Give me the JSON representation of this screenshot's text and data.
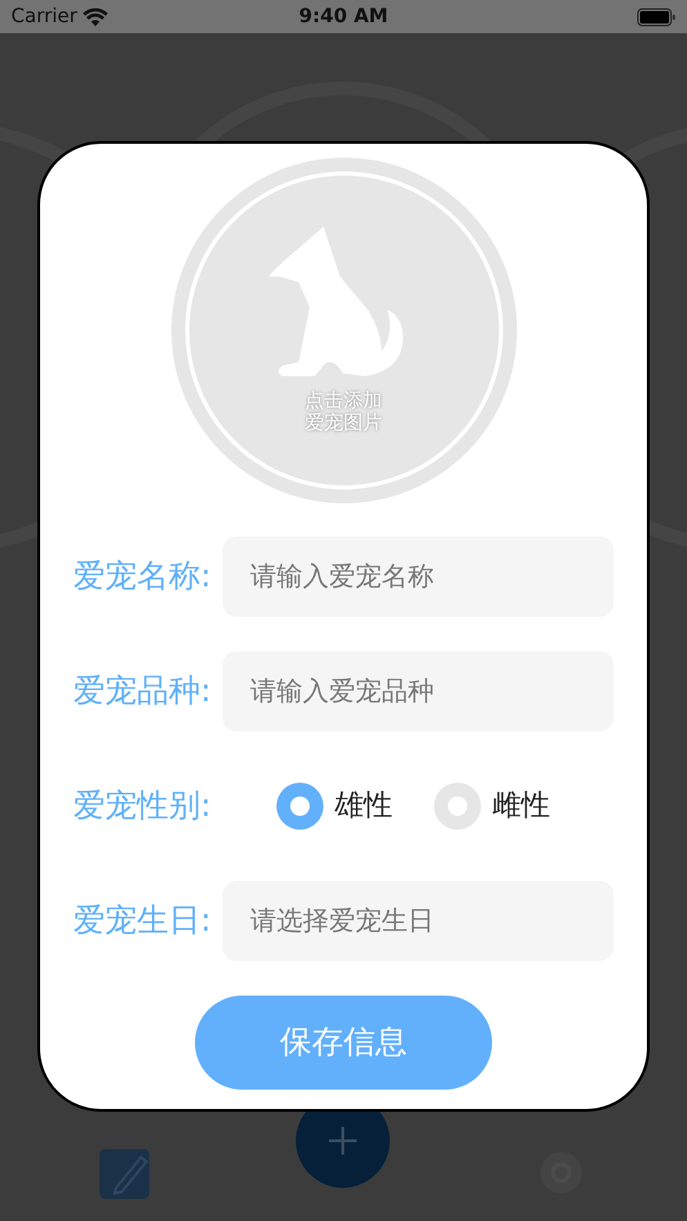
{
  "status_bar": {
    "carrier": "Carrier",
    "time": "9:40 AM"
  },
  "photo": {
    "caption_lines": [
      "点击添加",
      "爱宠图片"
    ]
  },
  "fields": [
    {
      "kind": "text",
      "label": "爱宠名称:",
      "placeholder": "请输入爱宠名称"
    },
    {
      "kind": "text",
      "label": "爱宠品种:",
      "placeholder": "请输入爱宠品种"
    },
    {
      "kind": "radio",
      "label": "爱宠性别:",
      "options": [
        {
          "label": "雄性",
          "selected": true
        },
        {
          "label": "雌性",
          "selected": false
        }
      ]
    },
    {
      "kind": "text",
      "label": "爱宠生日:",
      "placeholder": "请选择爱宠生日"
    }
  ],
  "save_button": {
    "label": "保存信息"
  }
}
